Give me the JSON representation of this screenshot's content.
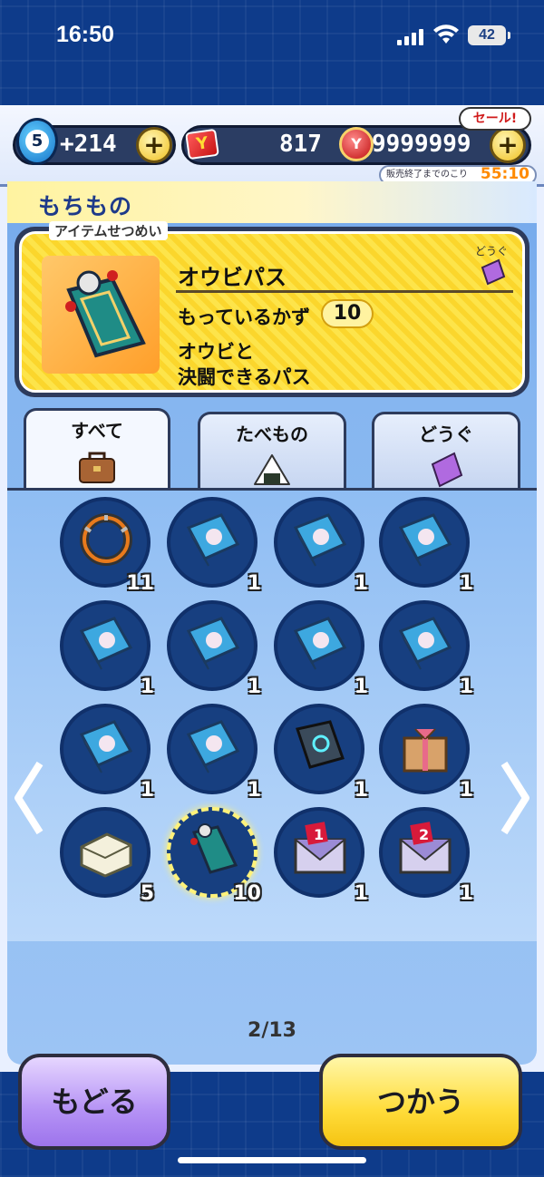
{
  "status_bar": {
    "time": "16:50",
    "battery": "42"
  },
  "resources": {
    "stamina_level": "5",
    "stamina_bonus": "+214",
    "tickets": "817",
    "coins": "9999999",
    "sale_label": "セール!",
    "sale_timer_label": "販売終了までのこり",
    "sale_timer_value": "55:10"
  },
  "section": {
    "title": "もちもの"
  },
  "description": {
    "tab_label": "アイテムせつめい",
    "category": "どうぐ",
    "item_name": "オウビパス",
    "count_label": "もっているかず",
    "count_value": "10",
    "text_line1": "オウビと",
    "text_line2": "決闘できるパス"
  },
  "tabs": [
    {
      "label": "すべて",
      "icon": "bag-icon"
    },
    {
      "label": "たべもの",
      "icon": "onigiri-icon"
    },
    {
      "label": "どうぐ",
      "icon": "ticket-icon"
    }
  ],
  "items": [
    {
      "icon": "spiked-collar-icon",
      "count": "11"
    },
    {
      "icon": "book-icon",
      "count": "1"
    },
    {
      "icon": "book-icon",
      "count": "1"
    },
    {
      "icon": "book-icon",
      "count": "1"
    },
    {
      "icon": "book-icon",
      "count": "1"
    },
    {
      "icon": "book-icon",
      "count": "1"
    },
    {
      "icon": "book-icon",
      "count": "1"
    },
    {
      "icon": "book-icon",
      "count": "1"
    },
    {
      "icon": "book-icon",
      "count": "1"
    },
    {
      "icon": "book-icon",
      "count": "1"
    },
    {
      "icon": "dark-book-icon",
      "count": "1"
    },
    {
      "icon": "gift-box-icon",
      "count": "1"
    },
    {
      "icon": "tofu-icon",
      "count": "5"
    },
    {
      "icon": "obi-pass-icon",
      "count": "10",
      "selected": true
    },
    {
      "icon": "envelope-1-icon",
      "count": "1"
    },
    {
      "icon": "envelope-2-icon",
      "count": "1"
    }
  ],
  "pagination": {
    "page": "2/13"
  },
  "buttons": {
    "back": "もどる",
    "use": "つかう"
  }
}
